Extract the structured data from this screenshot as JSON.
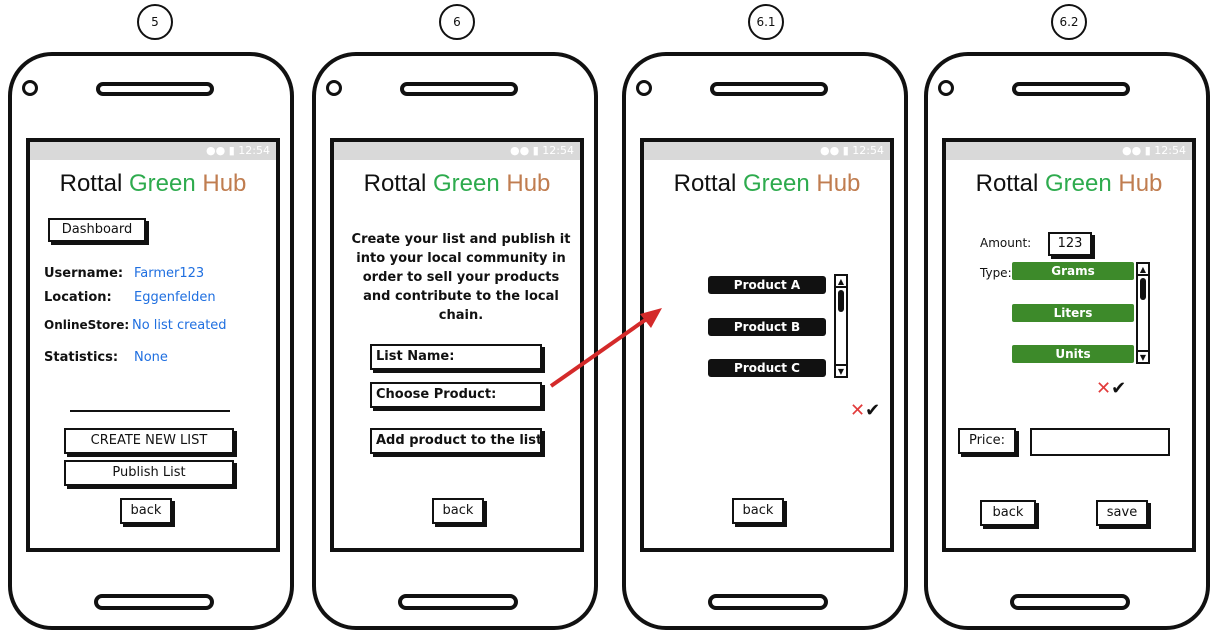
{
  "step_numbers": [
    "5",
    "6",
    "6.1",
    "6.2"
  ],
  "status_time": "12:54",
  "status_icons": "wifi-signal-battery-icons",
  "brand": {
    "word1": "Rottal",
    "word2": "Green",
    "word3": "Hub"
  },
  "colors": {
    "green": "#2eab4e",
    "brown": "#c07d50",
    "link_blue": "#1f6fe0",
    "arrow_red": "#d42a2a",
    "option_green": "#3d8a2a"
  },
  "screen5": {
    "dashboard_label": "Dashboard",
    "fields": [
      {
        "label": "Username:",
        "value": "Farmer123"
      },
      {
        "label": "Location:",
        "value": "Eggenfelden"
      },
      {
        "label": "OnlineStore:",
        "value": "No list created"
      },
      {
        "label": "Statistics:",
        "value": "None"
      }
    ],
    "create_label": "CREATE NEW LIST",
    "publish_label": "Publish List",
    "back_label": "back"
  },
  "screen6": {
    "description": "Create your list and publish it into your local community in order to sell your products and contribute to the local chain.",
    "list_name_label": "List Name:",
    "choose_product_label": "Choose Product:",
    "add_product_label": "Add product to the list",
    "back_label": "back"
  },
  "screen61": {
    "products": [
      "Product A",
      "Product B",
      "Product C"
    ],
    "cancel_mark": "✕",
    "confirm_mark": "✔",
    "back_label": "back"
  },
  "screen62": {
    "amount_label": "Amount:",
    "amount_value": "123",
    "type_label": "Type:",
    "types": [
      "Grams",
      "Liters",
      "Units"
    ],
    "cancel_mark": "✕",
    "confirm_mark": "✔",
    "price_label": "Price:",
    "price_value": "",
    "back_label": "back",
    "save_label": "save"
  }
}
